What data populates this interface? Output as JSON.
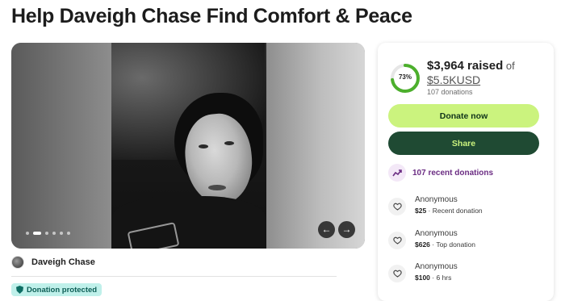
{
  "page": {
    "title": "Help Daveigh Chase Find Comfort & Peace"
  },
  "hero": {
    "slide_count": 6,
    "active_slide": 1,
    "prev_label": "←",
    "next_label": "→"
  },
  "organizer": {
    "name": "Daveigh Chase"
  },
  "protection_badge": {
    "label": "Donation protected"
  },
  "fundraiser": {
    "progress_percent": 73,
    "progress_label": "73%",
    "raised": "$3,964 raised",
    "of": " of",
    "goal": "$5.5KUSD",
    "donation_count": "107 donations",
    "donate_label": "Donate now",
    "share_label": "Share",
    "recent_label": "107 recent donations",
    "donors": [
      {
        "name": "Anonymous",
        "amount": "$25",
        "note": " · Recent donation"
      },
      {
        "name": "Anonymous",
        "amount": "$626",
        "note": " · Top donation"
      },
      {
        "name": "Anonymous",
        "amount": "$100",
        "note": " · 6 hrs"
      }
    ]
  },
  "colors": {
    "donate_bg": "#cbf37e",
    "share_bg": "#1f4a33",
    "progress": "#4caf2c",
    "badge_bg": "#bff0ea",
    "recent_text": "#6b2d83"
  }
}
